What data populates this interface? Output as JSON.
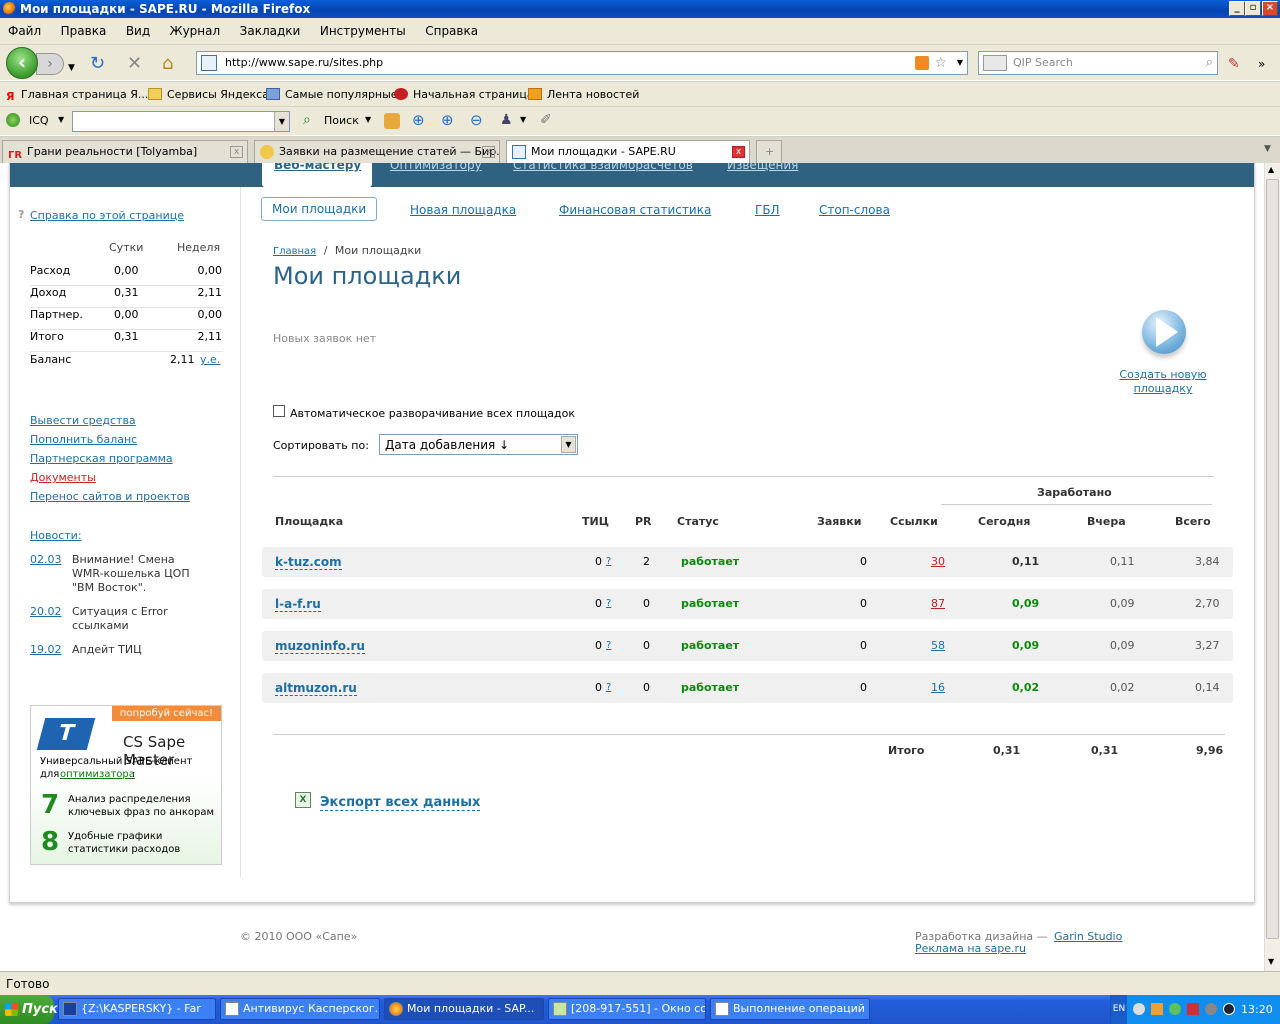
{
  "window": {
    "title": "Мои площадки - SAPE.RU - Mozilla Firefox"
  },
  "menu": [
    "Файл",
    "Правка",
    "Вид",
    "Журнал",
    "Закладки",
    "Инструменты",
    "Справка"
  ],
  "nav": {
    "url": "http://www.sape.ru/sites.php",
    "search_placeholder": "QIP Search"
  },
  "bookmarks": [
    "Главная страница Я...",
    "Сервисы Яндекса",
    "Самые популярные",
    "Начальная страница",
    "Лента новостей"
  ],
  "icqbar": {
    "icq": "ICQ",
    "search": "Поиск"
  },
  "tabs": [
    {
      "label": "Грани реальности [Tolyamba]"
    },
    {
      "label": "Заявки на размещение статей — Бир..."
    },
    {
      "label": "Мои площадки - SAPE.RU"
    }
  ],
  "topnav": [
    "Веб-мастеру",
    "Оптимизатору",
    "Статистика взаиморасчетов",
    "Извещения"
  ],
  "sidebar": {
    "help": "Справка по этой странице",
    "col_day": "Сутки",
    "col_week": "Неделя",
    "stats": [
      {
        "label": "Расход",
        "day": "0,00",
        "week": "0,00"
      },
      {
        "label": "Доход",
        "day": "0,31",
        "week": "2,11"
      },
      {
        "label": "Партнер.",
        "day": "0,00",
        "week": "0,00"
      },
      {
        "label": "Итого",
        "day": "0,31",
        "week": "2,11"
      }
    ],
    "balance_label": "Баланс",
    "balance_value": "2,11",
    "balance_unit": "у.е.",
    "links": [
      "Вывести средства",
      "Пополнить баланс",
      "Партнерская программа",
      "Документы",
      "Перенос сайтов и проектов"
    ],
    "news_title": "Новости:",
    "news": [
      {
        "date": "02.03",
        "text": "Внимание! Смена WMR-кошелька ЦОП \"ВМ Восток\"."
      },
      {
        "date": "20.02",
        "text": "Ситуация с Error ссылками"
      },
      {
        "date": "19.02",
        "text": "Апдейт ТИЦ"
      }
    ],
    "promo": {
      "badge": "попробуй сейчас!",
      "title": "CS Sape Master",
      "desc1": "Универсальный SAPE-клиент",
      "desc2": "для",
      "desc_link": "оптимизатора",
      "desc3": ":",
      "item7": "Анализ распределения ключевых фраз по анкорам",
      "item8": "Удобные графики статистики расходов",
      "num7": "7",
      "num8": "8"
    }
  },
  "subtabs": [
    "Мои площадки",
    "Новая площадка",
    "Финансовая статистика",
    "ГБЛ",
    "Стоп-слова"
  ],
  "breadcrumb": {
    "home": "Главная",
    "sep": "/",
    "current": "Мои площадки"
  },
  "page_title": "Мои площадки",
  "no_requests": "Новых заявок нет",
  "create_link": "Создать новую площадку",
  "auto_expand": "Автоматическое разворачивание всех площадок",
  "sort_label": "Сортировать по:",
  "sort_value": "Дата добавления ↓",
  "table": {
    "earned": "Заработано",
    "headers": {
      "site": "Площадка",
      "tic": "ТИЦ",
      "pr": "PR",
      "status": "Статус",
      "requests": "Заявки",
      "links": "Ссылки",
      "today": "Сегодня",
      "yesterday": "Вчера",
      "total": "Всего"
    },
    "rows": [
      {
        "site": "k-tuz.com",
        "tic": "0",
        "q": "?",
        "pr": "2",
        "status": "работает",
        "requests": "0",
        "links": "30",
        "today": "0,11",
        "yesterday": "0,11",
        "total": "3,84"
      },
      {
        "site": "l-a-f.ru",
        "tic": "0",
        "q": "?",
        "pr": "0",
        "status": "работает",
        "requests": "0",
        "links": "87",
        "today": "0,09",
        "yesterday": "0,09",
        "total": "2,70"
      },
      {
        "site": "muzoninfo.ru",
        "tic": "0",
        "q": "?",
        "pr": "0",
        "status": "работает",
        "requests": "0",
        "links": "58",
        "today": "0,09",
        "yesterday": "0,09",
        "total": "3,27"
      },
      {
        "site": "altmuzon.ru",
        "tic": "0",
        "q": "?",
        "pr": "0",
        "status": "работает",
        "requests": "0",
        "links": "16",
        "today": "0,02",
        "yesterday": "0,02",
        "total": "0,14"
      }
    ],
    "total_label": "Итого",
    "total_today": "0,31",
    "total_yesterday": "0,31",
    "total_all": "9,96"
  },
  "export": "Экспорт всех данных",
  "footer": {
    "copyright": "© 2010 ООО «Сапе»",
    "design": "Разработка дизайна —",
    "design_link": "Garin Studio",
    "ads": "Реклама на sape.ru"
  },
  "statusbar": "Готово",
  "taskbar": {
    "start": "Пуск",
    "items": [
      "{Z:\\KASPERSKY} - Far",
      "Антивирус Касперског...",
      "Мои площадки - SAP...",
      "[208-917-551] - Окно со...",
      "Выполнение операций ..."
    ],
    "lang": "EN",
    "clock": "13:20"
  },
  "colors": {
    "accent": "#1d6fa3",
    "nav": "#2f6181",
    "green": "#0a8a0a",
    "red": "#b22222"
  }
}
